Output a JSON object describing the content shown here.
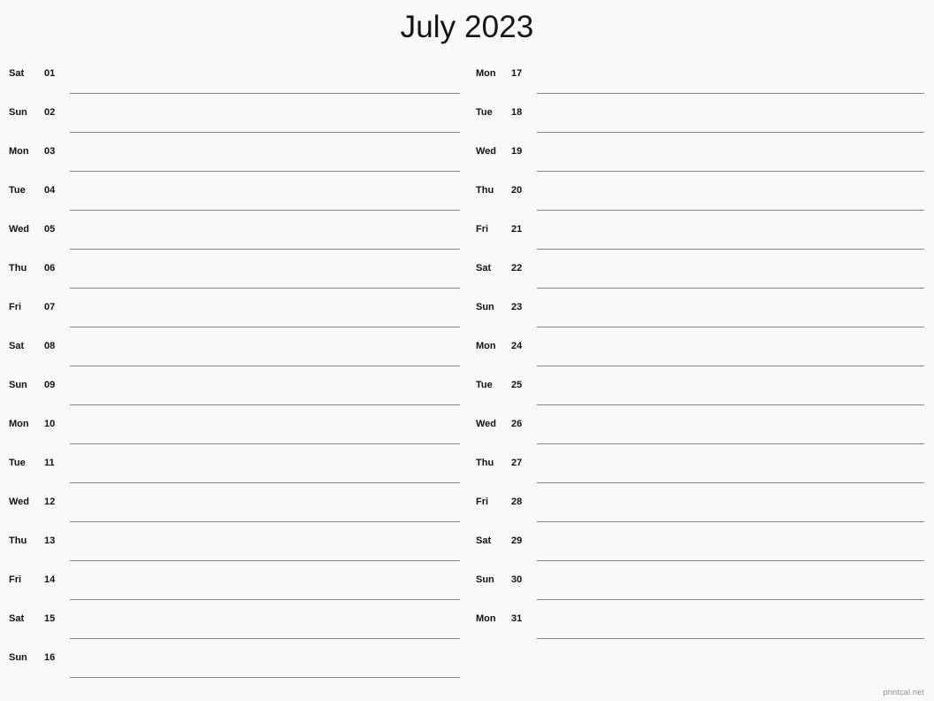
{
  "document": {
    "title": "July 2023",
    "background_color": "#faf9f8",
    "text_color": "#111111",
    "rule_color": "#888888"
  },
  "footer": {
    "watermark": "printcal.net",
    "color": "#8e8e8e"
  },
  "calendar": {
    "month": "July",
    "year": "2023",
    "columns": [
      {
        "name": "left-column",
        "days": [
          {
            "weekday": "Sat",
            "day": "01"
          },
          {
            "weekday": "Sun",
            "day": "02"
          },
          {
            "weekday": "Mon",
            "day": "03"
          },
          {
            "weekday": "Tue",
            "day": "04"
          },
          {
            "weekday": "Wed",
            "day": "05"
          },
          {
            "weekday": "Thu",
            "day": "06"
          },
          {
            "weekday": "Fri",
            "day": "07"
          },
          {
            "weekday": "Sat",
            "day": "08"
          },
          {
            "weekday": "Sun",
            "day": "09"
          },
          {
            "weekday": "Mon",
            "day": "10"
          },
          {
            "weekday": "Tue",
            "day": "11"
          },
          {
            "weekday": "Wed",
            "day": "12"
          },
          {
            "weekday": "Thu",
            "day": "13"
          },
          {
            "weekday": "Fri",
            "day": "14"
          },
          {
            "weekday": "Sat",
            "day": "15"
          },
          {
            "weekday": "Sun",
            "day": "16"
          }
        ]
      },
      {
        "name": "right-column",
        "days": [
          {
            "weekday": "Mon",
            "day": "17"
          },
          {
            "weekday": "Tue",
            "day": "18"
          },
          {
            "weekday": "Wed",
            "day": "19"
          },
          {
            "weekday": "Thu",
            "day": "20"
          },
          {
            "weekday": "Fri",
            "day": "21"
          },
          {
            "weekday": "Sat",
            "day": "22"
          },
          {
            "weekday": "Sun",
            "day": "23"
          },
          {
            "weekday": "Mon",
            "day": "24"
          },
          {
            "weekday": "Tue",
            "day": "25"
          },
          {
            "weekday": "Wed",
            "day": "26"
          },
          {
            "weekday": "Thu",
            "day": "27"
          },
          {
            "weekday": "Fri",
            "day": "28"
          },
          {
            "weekday": "Sat",
            "day": "29"
          },
          {
            "weekday": "Sun",
            "day": "30"
          },
          {
            "weekday": "Mon",
            "day": "31"
          }
        ]
      }
    ]
  }
}
